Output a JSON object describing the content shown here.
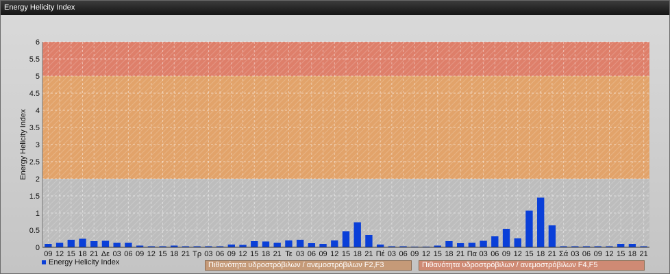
{
  "window": {
    "title": "Energy Helicity Index"
  },
  "chart_data": {
    "type": "bar",
    "title": "",
    "ylabel": "Energy Helicity Index",
    "xlabel": "",
    "ylim": [
      0,
      6
    ],
    "yticks": [
      "0",
      "0.5",
      "1",
      "1.5",
      "2",
      "2.5",
      "3",
      "3.5",
      "4",
      "4.5",
      "5",
      "5.5",
      "6"
    ],
    "categories": [
      "09",
      "12",
      "15",
      "18",
      "21",
      "Δε",
      "03",
      "06",
      "09",
      "12",
      "15",
      "18",
      "21",
      "Τρ",
      "03",
      "06",
      "09",
      "12",
      "15",
      "18",
      "21",
      "Τε",
      "03",
      "06",
      "09",
      "12",
      "15",
      "18",
      "21",
      "Πέ",
      "03",
      "06",
      "09",
      "12",
      "15",
      "18",
      "21",
      "Πα",
      "03",
      "06",
      "09",
      "12",
      "15",
      "18",
      "21",
      "Σά",
      "03",
      "06",
      "09",
      "12",
      "15",
      "18",
      "21"
    ],
    "series": [
      {
        "name": "Energy Helicity Index",
        "color": "#0a3fd8",
        "values": [
          0.1,
          0.13,
          0.22,
          0.25,
          0.18,
          0.19,
          0.13,
          0.13,
          0.05,
          0.03,
          0.03,
          0.05,
          0.03,
          0.03,
          0.03,
          0.03,
          0.08,
          0.07,
          0.18,
          0.17,
          0.13,
          0.2,
          0.22,
          0.12,
          0.1,
          0.2,
          0.47,
          0.73,
          0.36,
          0.08,
          0.03,
          0.03,
          0.02,
          0.02,
          0.05,
          0.18,
          0.12,
          0.13,
          0.19,
          0.32,
          0.54,
          0.26,
          1.07,
          1.45,
          0.64,
          0.03,
          0.03,
          0.03,
          0.03,
          0.03,
          0.1,
          0.1,
          0.03
        ]
      }
    ],
    "bands": [
      {
        "from": 0,
        "to": 2,
        "color": "#bdbdbd"
      },
      {
        "from": 2,
        "to": 5,
        "color": "#e2a36a"
      },
      {
        "from": 5,
        "to": 6,
        "color": "#de7f6a"
      }
    ],
    "grid": true,
    "legend": {
      "series_label": "Energy Helicity Index",
      "band_f2f3": "Πιθανότητα υδροστρόβιλων / ανεμοστρόβιλων F2,F3",
      "band_f4f5": "Πιθανότητα υδροστρόβιλων / ανεμοστρόβιλων F4,F5"
    }
  }
}
